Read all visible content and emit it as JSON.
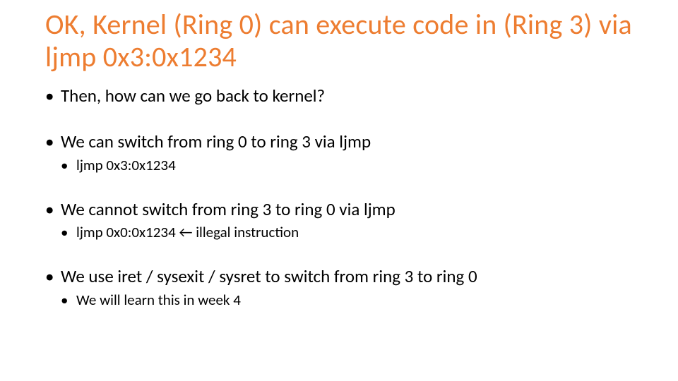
{
  "slide": {
    "title": "OK, Kernel (Ring 0) can execute code in (Ring 3) via ljmp 0x3:0x1234",
    "bullets": [
      {
        "text": "Then, how can we go back to kernel?",
        "sub": []
      },
      {
        "text": "We can switch from ring 0 to ring 3 via ljmp",
        "sub": [
          "ljmp 0x3:0x1234"
        ]
      },
      {
        "text": "We cannot switch from ring 3 to ring 0 via ljmp",
        "sub": [
          "ljmp 0x0:0x1234 ← illegal instruction"
        ]
      },
      {
        "text": "We use iret / sysexit / sysret to switch from ring 3 to ring 0",
        "sub": [
          "We will learn this in week 4"
        ]
      }
    ]
  }
}
